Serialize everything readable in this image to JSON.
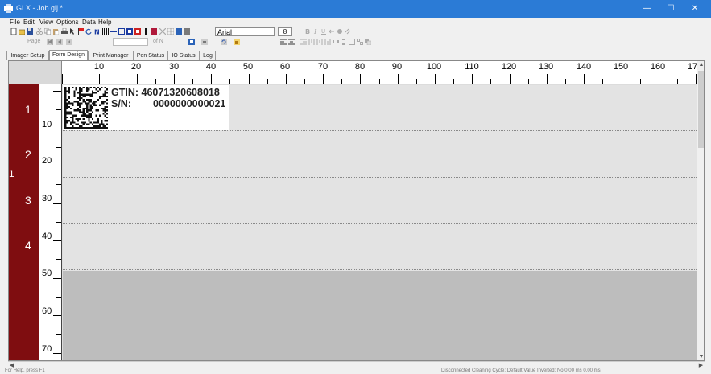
{
  "window": {
    "title": "GLX - Job.glj *",
    "minimize_glyph": "—",
    "maximize_glyph": "☐",
    "close_glyph": "✕"
  },
  "menu": [
    "File",
    "Edit",
    "View",
    "Options",
    "Data",
    "Help"
  ],
  "toolbar": {
    "font_name": "Arial",
    "font_size": "8",
    "page_label": "Page",
    "of_label": "of N"
  },
  "tabs": [
    "Imager Setup",
    "Form Design",
    "Print Manager",
    "Pen Status",
    "IO Status",
    "Log"
  ],
  "active_tab": "Form Design",
  "ruler": {
    "horizontal": [
      "10",
      "20",
      "30",
      "40",
      "50",
      "60",
      "70",
      "80",
      "90",
      "100",
      "110",
      "120",
      "130",
      "140",
      "150",
      "160",
      "17"
    ],
    "vertical": [
      "10",
      "20",
      "30",
      "40",
      "50",
      "60",
      "70"
    ]
  },
  "rows": {
    "numbers": [
      "1",
      "2",
      "3",
      "4"
    ],
    "head": "1"
  },
  "label": {
    "gtin_text": "GTIN: 46071320608018",
    "sn_label": "S/N:",
    "sn_value": "0000000000021"
  },
  "status": {
    "left": "For Help, press F1",
    "right": "Disconnected     Cleaning Cycle: Default Value     Inverted: No     0.00 ms     0.00 ms"
  },
  "colors": {
    "title_bar": "#2b7bd6",
    "row_strip": "#7f0d10",
    "canvas": "#e3e3e3",
    "unused_area": "#bdbdbd"
  },
  "icons": {
    "app": "printer-app-icon",
    "datamatrix": "datamatrix-barcode"
  }
}
